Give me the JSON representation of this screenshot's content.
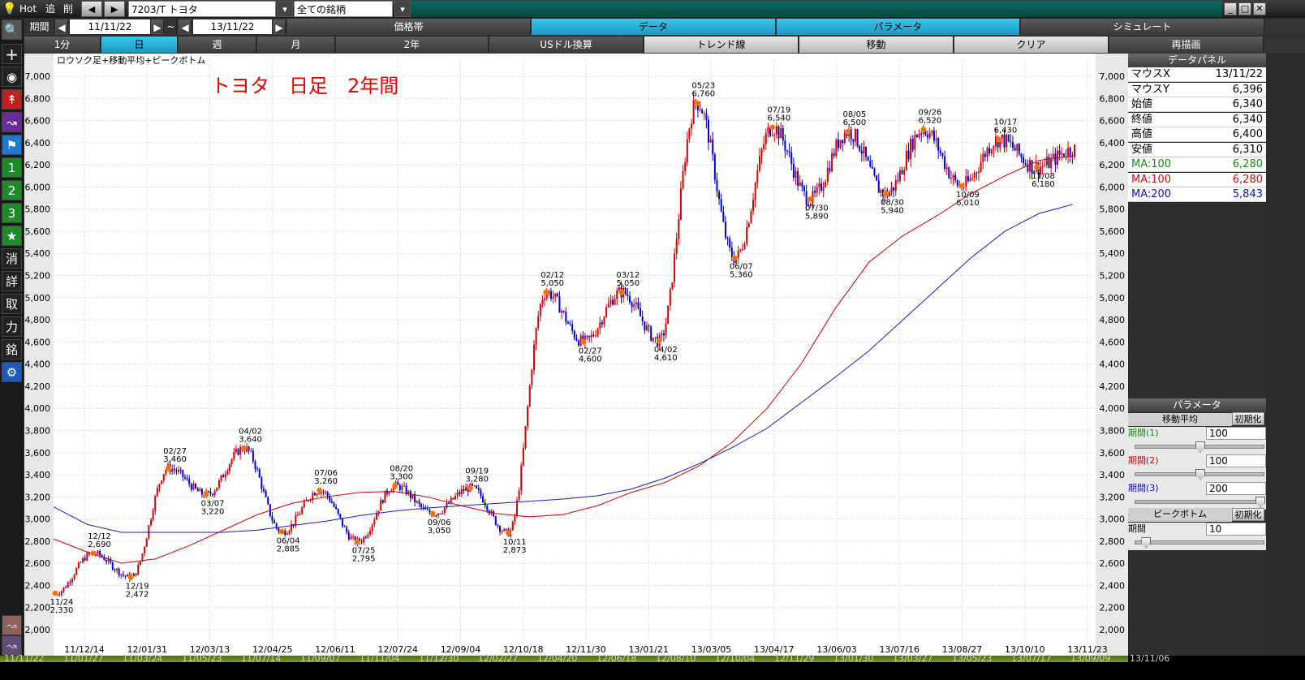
{
  "toolbar": {
    "hot": "Hot",
    "add": "追",
    "del": "削",
    "symbol": "7203/T トヨタ",
    "universe": "全ての銘柄"
  },
  "period_row": {
    "label": "期間",
    "from": "11/11/22",
    "tilde": "~",
    "to": "13/11/22",
    "tabs": [
      "価格帯",
      "データ",
      "パラメータ",
      "シミュレート"
    ],
    "selected_tab": "データ"
  },
  "range_row": {
    "buttons": [
      "1分",
      "日",
      "週",
      "月",
      "2年",
      "USドル換算",
      "トレンド線",
      "移動",
      "クリア",
      "再描画"
    ],
    "selected": "日"
  },
  "sidebar": {
    "icons": [
      "search-icon",
      "plus-icon",
      "camera-icon",
      "line-chart-icon",
      "area-chart-icon",
      "flag-icon"
    ],
    "numbers": [
      "1",
      "2",
      "3"
    ],
    "star": "★",
    "kanji": [
      "消",
      "詳",
      "取",
      "力",
      "銘"
    ],
    "gear": "⚙"
  },
  "chart": {
    "subtitle": "ロウソク足+移動平均+ピークボトム",
    "title": "トヨタ　日足　2年間",
    "colors": {
      "up": "#d00000",
      "down": "#0000cc",
      "ma_red": "#d00000",
      "ma_blue": "#1a1acc",
      "peak": "#ff6600",
      "title": "#e00000"
    },
    "yticks": [
      "7,000",
      "6,800",
      "6,600",
      "6,400",
      "6,200",
      "6,000",
      "5,800",
      "5,600",
      "5,400",
      "5,200",
      "5,000",
      "4,800",
      "4,600",
      "4,400",
      "4,200",
      "4,000",
      "3,800",
      "3,600",
      "3,400",
      "3,200",
      "3,000",
      "2,800",
      "2,600",
      "2,400",
      "2,200",
      "2,000"
    ],
    "xticks": [
      "11/12/14",
      "12/01/31",
      "12/03/13",
      "12/04/25",
      "12/06/11",
      "12/07/24",
      "12/09/04",
      "12/10/18",
      "12/11/30",
      "13/01/21",
      "13/03/05",
      "13/04/17",
      "13/06/03",
      "13/07/16",
      "13/08/27",
      "13/10/10",
      "13/11/23"
    ],
    "points": [
      {
        "d": "11/24",
        "v": "2,330"
      },
      {
        "d": "12/12",
        "v": "2,690"
      },
      {
        "d": "12/19",
        "v": "2,472"
      },
      {
        "d": "02/27",
        "v": "3,460"
      },
      {
        "d": "03/07",
        "v": "3,220"
      },
      {
        "d": "04/02",
        "v": "3,640"
      },
      {
        "d": "06/04",
        "v": "2,885"
      },
      {
        "d": "07/06",
        "v": "3,260"
      },
      {
        "d": "07/25",
        "v": "2,795"
      },
      {
        "d": "08/20",
        "v": "3,300"
      },
      {
        "d": "09/06",
        "v": "3,050"
      },
      {
        "d": "09/19",
        "v": "3,280"
      },
      {
        "d": "10/11",
        "v": "2,873"
      },
      {
        "d": "02/12",
        "v": "5,050"
      },
      {
        "d": "02/27",
        "v": "4,600"
      },
      {
        "d": "03/12",
        "v": "5,050"
      },
      {
        "d": "04/02",
        "v": "4,610"
      },
      {
        "d": "05/23",
        "v": "6,760"
      },
      {
        "d": "06/07",
        "v": "5,360"
      },
      {
        "d": "07/19",
        "v": "6,540"
      },
      {
        "d": "07/30",
        "v": "5,890"
      },
      {
        "d": "08/05",
        "v": "6,500"
      },
      {
        "d": "08/30",
        "v": "5,940"
      },
      {
        "d": "09/26",
        "v": "6,520"
      },
      {
        "d": "10/09",
        "v": "6,010"
      },
      {
        "d": "10/17",
        "v": "6,430"
      },
      {
        "d": "11/08",
        "v": "6,180"
      }
    ]
  },
  "chart_data": {
    "type": "line",
    "title": "トヨタ　日足　2年間",
    "ylim": [
      2000,
      7000
    ],
    "series": [
      {
        "name": "MA:100",
        "values": [
          2820,
          2700,
          2600,
          2640,
          2760,
          2900,
          3040,
          3140,
          3200,
          3240,
          3250,
          3200,
          3120,
          3050,
          3020,
          3040,
          3120,
          3240,
          3330,
          3480,
          3700,
          4000,
          4400,
          4900,
          5320,
          5560,
          5740,
          5940,
          6100,
          6240,
          6280
        ]
      },
      {
        "name": "MA:200",
        "values": [
          3110,
          2950,
          2880,
          2880,
          2880,
          2880,
          2900,
          2940,
          2980,
          3030,
          3070,
          3100,
          3120,
          3140,
          3160,
          3180,
          3210,
          3270,
          3370,
          3500,
          3650,
          3820,
          4050,
          4280,
          4520,
          4800,
          5080,
          5360,
          5600,
          5760,
          5843
        ]
      },
      {
        "name": "price",
        "values": [
          2330,
          2690,
          2472,
          3460,
          3220,
          3640,
          2885,
          3260,
          2795,
          3300,
          3050,
          3280,
          2873,
          5050,
          4600,
          5050,
          4610,
          6760,
          5360,
          6540,
          5890,
          6500,
          5940,
          6520,
          6010,
          6430,
          6180,
          6340
        ]
      }
    ]
  },
  "data_panel": {
    "title": "データパネル",
    "rows": [
      {
        "k": "マウスX",
        "v": "13/11/22"
      },
      {
        "k": "マウスY",
        "v": "6,396"
      },
      {
        "k": "始値",
        "v": "6,340"
      },
      {
        "k": "終値",
        "v": "6,340"
      },
      {
        "k": "高値",
        "v": "6,400"
      },
      {
        "k": "安値",
        "v": "6,310"
      },
      {
        "k": "MA:100",
        "v": "6,280"
      },
      {
        "k": "MA:100",
        "v": "6,280"
      },
      {
        "k": "MA:200",
        "v": "5,843"
      }
    ]
  },
  "param_panel": {
    "title": "パラメータ",
    "ma": "移動平均",
    "init": "初期化",
    "p1": "期間(1)",
    "v1": "100",
    "p2": "期間(2)",
    "v2": "100",
    "p3": "期間(3)",
    "v3": "200",
    "pb": "ピークボトム",
    "pbp": "期間",
    "pbv": "10",
    "levels": {
      "p1": 0.5,
      "p2": 0.5,
      "p3": 1.0,
      "pb": 0.05
    }
  },
  "bottom_dates": [
    "11/11/22",
    "11/01/27",
    "11/03/24",
    "11/05/23",
    "11/07/14",
    "11/09/07",
    "11/11/04",
    "11/12/30",
    "12/02/27",
    "12/04/20",
    "12/06/18",
    "12/08/10",
    "12/10/04",
    "12/11/29",
    "13/01/30",
    "13/03/27",
    "13/05/23",
    "13/07/17",
    "13/09/09",
    "13/11/06"
  ]
}
